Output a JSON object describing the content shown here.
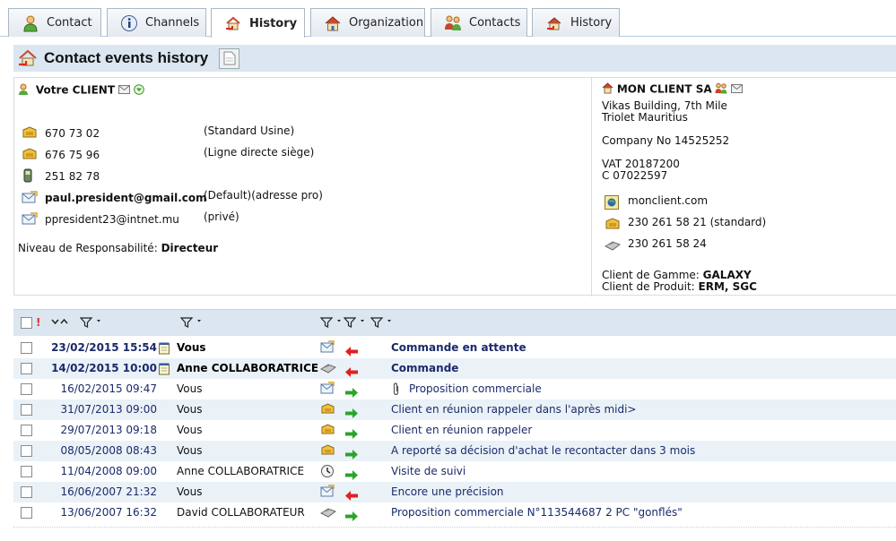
{
  "tabs": [
    {
      "label": "Contact",
      "icon": "person-icon"
    },
    {
      "label": "Channels",
      "icon": "info-icon"
    },
    {
      "label": "History",
      "icon": "history-icon",
      "active": true
    },
    {
      "label": "Organization",
      "icon": "house-icon"
    },
    {
      "label": "Contacts",
      "icon": "people-icon"
    },
    {
      "label": "History",
      "icon": "house-history-icon"
    }
  ],
  "header": {
    "title": "Contact events history"
  },
  "contact": {
    "name": "Votre CLIENT",
    "phones": [
      {
        "value": "670 73 02",
        "note": "(Standard Usine)"
      },
      {
        "value": "676 75 96",
        "note": "(Ligne directe siège)"
      },
      {
        "value": "251 82 78",
        "note": ""
      }
    ],
    "emails": [
      {
        "value": "paul.president@gmail.com",
        "note": "(Default)(adresse pro)"
      },
      {
        "value": "ppresident23@intnet.mu",
        "note": "(privé)"
      }
    ],
    "responsibility_label": "Niveau de Responsabilité:",
    "responsibility_value": "Directeur"
  },
  "organization": {
    "name": "MON CLIENT SA",
    "address1": "Vikas Building, 7th Mile",
    "address2": "Triolet Mauritius",
    "company_no": "Company No 14525252",
    "vat": "VAT 20187200",
    "c_code": "C 07022597",
    "website": "monclient.com",
    "phone": "230 261 58 21  (standard)",
    "fax": "230 261 58 24",
    "gamme_label": "Client de Gamme:",
    "gamme_value": "GALAXY",
    "produit_label": "Client de Produit:",
    "produit_value": "ERM, SGC"
  },
  "events": [
    {
      "date": "23/02/2015 15:54",
      "who": "Vous",
      "subject": "Commande en attente",
      "bold": true,
      "channel": "email",
      "direction": "in",
      "note": true,
      "attach": false
    },
    {
      "date": "14/02/2015 10:00",
      "who": "Anne COLLABORATRICE",
      "subject": "Commande",
      "bold": true,
      "channel": "fax",
      "direction": "in",
      "note": true,
      "attach": false
    },
    {
      "date": "16/02/2015 09:47",
      "who": "Vous",
      "subject": "Proposition commerciale",
      "bold": false,
      "channel": "email",
      "direction": "out",
      "note": false,
      "attach": true
    },
    {
      "date": "31/07/2013 09:00",
      "who": "Vous",
      "subject": "Client en réunion rappeler dans l'après midi>",
      "bold": false,
      "channel": "phone",
      "direction": "out",
      "note": false,
      "attach": false
    },
    {
      "date": "29/07/2013 09:18",
      "who": "Vous",
      "subject": "Client en réunion rappeler",
      "bold": false,
      "channel": "phone",
      "direction": "out",
      "note": false,
      "attach": false
    },
    {
      "date": "08/05/2008 08:43",
      "who": "Vous",
      "subject": "A reporté sa décision d'achat le recontacter dans 3 mois",
      "bold": false,
      "channel": "phone",
      "direction": "out",
      "note": false,
      "attach": false
    },
    {
      "date": "11/04/2008 09:00",
      "who": "Anne COLLABORATRICE",
      "subject": "Visite de suivi",
      "bold": false,
      "channel": "visit",
      "direction": "out",
      "note": false,
      "attach": false
    },
    {
      "date": "16/06/2007 21:32",
      "who": "Vous",
      "subject": "Encore une précision",
      "bold": false,
      "channel": "email",
      "direction": "in",
      "note": false,
      "attach": false
    },
    {
      "date": "13/06/2007 16:32",
      "who": "David COLLABORATEUR",
      "subject": "Proposition commerciale N°113544687 2 PC \"gonflés\"",
      "bold": false,
      "channel": "fax",
      "direction": "out",
      "note": false,
      "attach": false
    }
  ],
  "colors": {
    "header_bg": "#dbe6f1",
    "row_alt": "#eaf2f8",
    "link": "#1a2a6a",
    "in_arrow": "#e02020",
    "out_arrow": "#2aa52a"
  }
}
